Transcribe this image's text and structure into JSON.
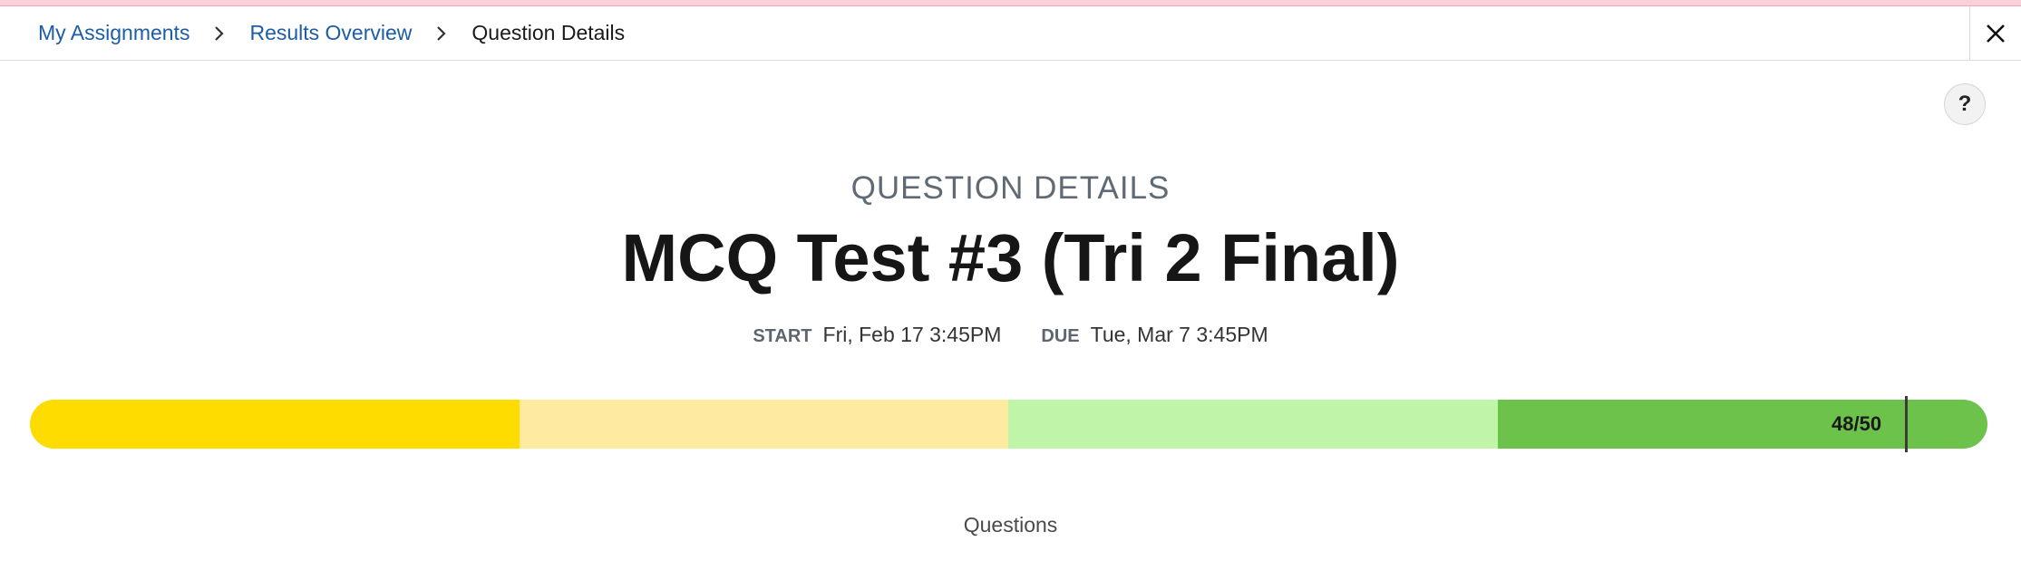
{
  "breadcrumb": {
    "items": [
      {
        "label": "My Assignments"
      },
      {
        "label": "Results Overview"
      },
      {
        "label": "Question Details"
      }
    ]
  },
  "icons": {
    "separator": "chevron-right-icon",
    "close": "close-icon",
    "help": "help-icon"
  },
  "help": {
    "label": "?"
  },
  "header": {
    "kicker": "QUESTION DETAILS",
    "title": "MCQ Test #3 (Tri 2 Final)",
    "start_label": "START",
    "start_value": "Fri, Feb 17 3:45PM",
    "due_label": "DUE",
    "due_value": "Tue, Mar 7 3:45PM"
  },
  "score": {
    "label": "48/50",
    "value": 48,
    "max": 50,
    "bands": [
      {
        "color": "#ffdc00"
      },
      {
        "color": "#ffeba0"
      },
      {
        "color": "#c0f4a8"
      },
      {
        "color": "#6cc24a"
      }
    ]
  },
  "sections": {
    "questions_label": "Questions"
  }
}
